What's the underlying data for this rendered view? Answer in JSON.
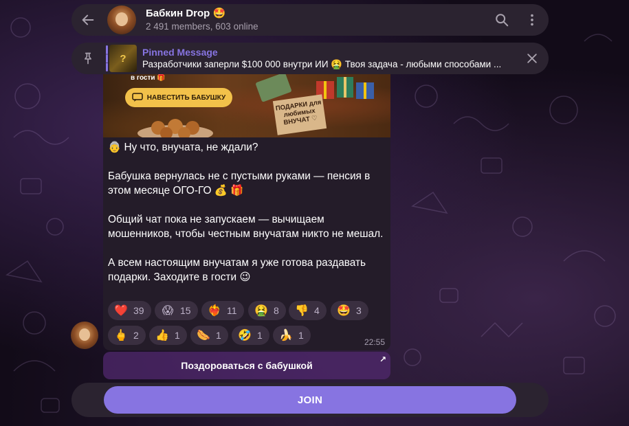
{
  "header": {
    "title": "Бабкин Drop 🤩",
    "subtitle": "2 491 members, 603 online"
  },
  "pinned": {
    "label": "Pinned Message",
    "thumb_text": "?",
    "preview": "Разработчики заперли $100 000 внутри ИИ 🤮 Твоя задача - любыми способами ..."
  },
  "message": {
    "image": {
      "caption": "в гости 🎁",
      "button_label": "НАВЕСТИТЬ БАБУШКУ",
      "sign_text": "ПОДАРКИ для любимых ВНУЧАТ ♡"
    },
    "paragraphs": [
      "👵  Ну что, внучата, не ждали?",
      "Бабушка вернулась не с пустыми руками — пенсия в этом месяце ОГО-ГО 💰 🎁",
      "Общий чат пока не запускаем — вычищаем мошенников, чтобы честным внучатам никто не мешал.",
      "А всем настоящим внучатам я уже готова раздавать подарки. Заходите в гости 😉"
    ],
    "reactions": [
      {
        "emoji": "❤️",
        "count": "39"
      },
      {
        "emoji": "😱",
        "count": "15"
      },
      {
        "emoji": "❤️‍🔥",
        "count": "11"
      },
      {
        "emoji": "🤮",
        "count": "8"
      },
      {
        "emoji": "👎",
        "count": "4"
      },
      {
        "emoji": "🤩",
        "count": "3"
      },
      {
        "emoji": "🖕",
        "count": "2"
      },
      {
        "emoji": "👍",
        "count": "1"
      },
      {
        "emoji": "🌭",
        "count": "1"
      },
      {
        "emoji": "🤣",
        "count": "1"
      },
      {
        "emoji": "🍌",
        "count": "1"
      }
    ],
    "time": "22:55"
  },
  "inline_button": {
    "label": "Поздороваться с бабушкой",
    "arrow": "↗"
  },
  "join": {
    "label": "JOIN"
  },
  "colors": {
    "accent": "#8774e1",
    "bar_bg": "#2b2330",
    "bubble_bg": "#241c29",
    "reaction_bg": "#3a2f40"
  }
}
